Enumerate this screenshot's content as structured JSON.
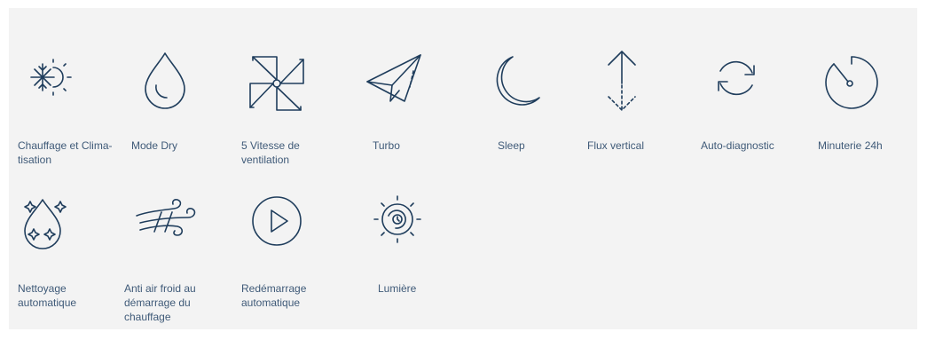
{
  "features": [
    {
      "label_line1": "Chauffage et Clima-",
      "label_line2": "tisation",
      "icon": "heat-cool-icon"
    },
    {
      "label_line1": "Mode Dry",
      "label_line2": "",
      "icon": "water-drop-icon"
    },
    {
      "label_line1": "5 Vitesse de",
      "label_line2": "ventilation",
      "icon": "pinwheel-icon"
    },
    {
      "label_line1": "Turbo",
      "label_line2": "",
      "icon": "paper-plane-icon"
    },
    {
      "label_line1": "Sleep",
      "label_line2": "",
      "icon": "moon-icon"
    },
    {
      "label_line1": "Flux vertical",
      "label_line2": "",
      "icon": "vertical-flow-icon"
    },
    {
      "label_line1": "Auto-diagnostic",
      "label_line2": "",
      "icon": "refresh-icon"
    },
    {
      "label_line1": "Minuterie 24h",
      "label_line2": "",
      "icon": "timer-icon"
    },
    {
      "label_line1": "Nettoyage",
      "label_line2": "automatique",
      "icon": "clean-drop-icon"
    },
    {
      "label_line1": "Anti air froid au",
      "label_line2": "démarrage du",
      "label_line3": "chauffage",
      "icon": "wind-icon"
    },
    {
      "label_line1": "Redémarrage",
      "label_line2": "automatique",
      "icon": "play-icon"
    },
    {
      "label_line1": "Lumière",
      "label_line2": "",
      "icon": "light-icon"
    }
  ]
}
